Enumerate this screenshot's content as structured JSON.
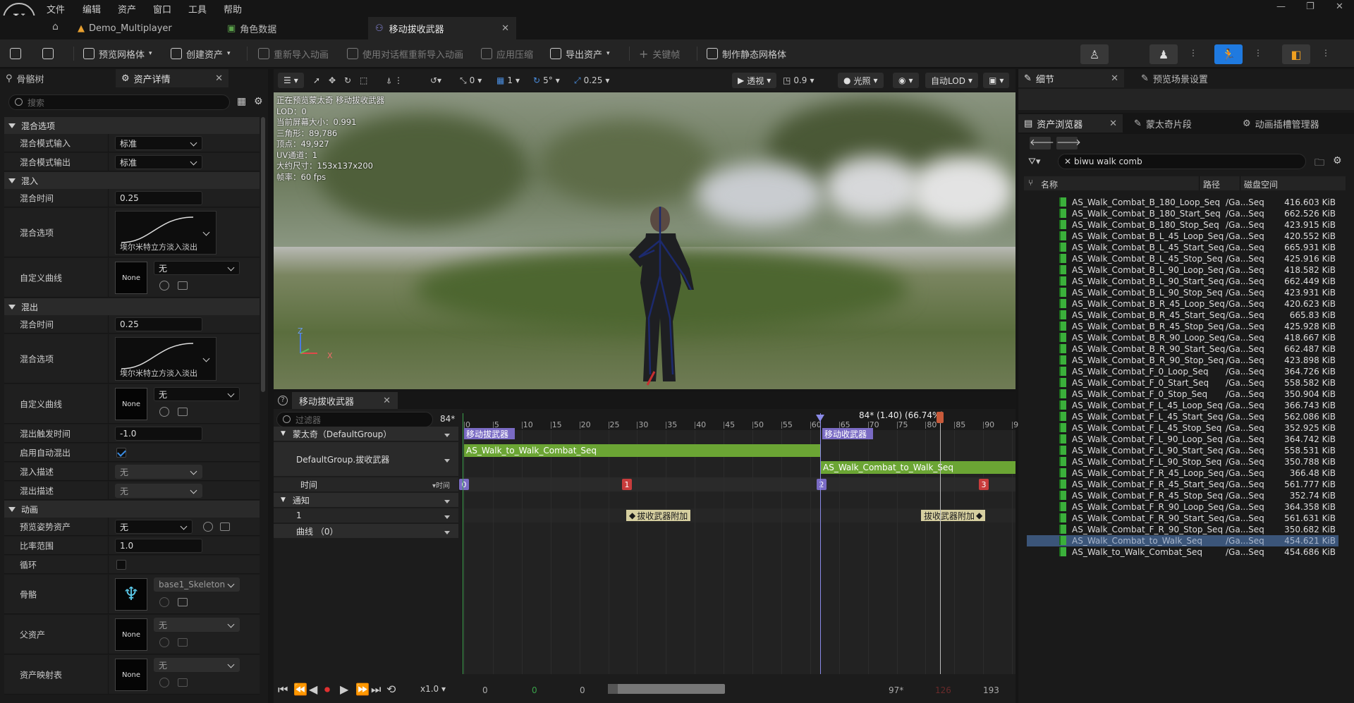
{
  "menu": {
    "items": [
      "文件",
      "编辑",
      "资产",
      "窗口",
      "工具",
      "帮助"
    ]
  },
  "tabs": [
    {
      "label": "Demo_Multiplayer"
    },
    {
      "label": "角色数据"
    },
    {
      "label": "移动拔收武器"
    }
  ],
  "toolbar": {
    "preview_mesh": "预览网格体",
    "create_asset": "创建资产",
    "reimport": "重新导入动画",
    "reimport_dialog": "使用对话框重新导入动画",
    "apply_compression": "应用压缩",
    "export_asset": "导出资产",
    "keyframe": "关键帧",
    "make_static_mesh": "制作静态网格体"
  },
  "left_panel": {
    "tabs": [
      "骨骼树",
      "资产详情"
    ],
    "search_placeholder": "搜索",
    "cat_blend": "混合选项",
    "blend_in_mode_label": "混合模式输入",
    "blend_in_mode": "标准",
    "blend_out_mode_label": "混合模式输出",
    "blend_out_mode": "标准",
    "cat_blendin": "混入",
    "blend_time_label": "混合时间",
    "blend_in_time": "0.25",
    "blend_option_label": "混合选项",
    "curve_caption": "埃尔米特立方淡入淡出",
    "custom_curve_label": "自定义曲线",
    "none_thumb": "None",
    "none_value": "无",
    "cat_blendout": "混出",
    "blend_out_time": "0.25",
    "blend_out_trigger_label": "混出触发时间",
    "blend_out_trigger": "-1.0",
    "auto_blend_out_label": "启用自动混出",
    "blend_in_profile_label": "混入描述",
    "blend_in_profile": "无",
    "blend_out_profile_label": "混出描述",
    "blend_out_profile": "无",
    "cat_anim": "动画",
    "preview_pose_label": "预览姿势资产",
    "preview_pose": "无",
    "rate_scale_label": "比率范围",
    "rate_scale": "1.0",
    "loop_label": "循环",
    "skeleton_label": "骨骼",
    "skeleton": "base1_Skeleton",
    "parent_asset_label": "父资产",
    "parent_asset": "无",
    "asset_mapping_label": "资产映射表",
    "asset_mapping": "无"
  },
  "viewport": {
    "toolbar": {
      "rot": "0",
      "grid": "1",
      "angle": "5°",
      "scale": "0.25",
      "perspective": "透视",
      "fov": "0.9",
      "lit": "光照",
      "lod": "自动LOD"
    },
    "stats": [
      "正在预览蒙太奇 移动拔收武器",
      "LOD：0",
      "当前屏幕大小：0.991",
      "三角形：89,786",
      "顶点：49,927",
      "UV通道：1",
      "大约尺寸：153x137x200",
      "帧率：60 fps"
    ],
    "axis_z": "Z",
    "axis_x": "X"
  },
  "right_panel": {
    "tabs": [
      "细节",
      "预览场景设置"
    ],
    "subtabs": [
      "资产浏览器",
      "蒙太奇片段",
      "动画插槽管理器"
    ],
    "search_value": "biwu walk comb",
    "columns": [
      "名称",
      "路径",
      "磁盘空间"
    ],
    "assets": [
      {
        "name": "AS_Walk_Combat_B_180_Loop_Seq",
        "path": "/Ga...Seq",
        "size": "416.603 KiB"
      },
      {
        "name": "AS_Walk_Combat_B_180_Start_Seq",
        "path": "/Ga...Seq",
        "size": "662.526 KiB"
      },
      {
        "name": "AS_Walk_Combat_B_180_Stop_Seq",
        "path": "/Ga...Seq",
        "size": "423.915 KiB"
      },
      {
        "name": "AS_Walk_Combat_B_L_45_Loop_Seq",
        "path": "/Ga...Seq",
        "size": "420.552 KiB"
      },
      {
        "name": "AS_Walk_Combat_B_L_45_Start_Seq",
        "path": "/Ga...Seq",
        "size": "665.931 KiB"
      },
      {
        "name": "AS_Walk_Combat_B_L_45_Stop_Seq",
        "path": "/Ga...Seq",
        "size": "425.916 KiB"
      },
      {
        "name": "AS_Walk_Combat_B_L_90_Loop_Seq",
        "path": "/Ga...Seq",
        "size": "418.582 KiB"
      },
      {
        "name": "AS_Walk_Combat_B_L_90_Start_Seq",
        "path": "/Ga...Seq",
        "size": "662.449 KiB"
      },
      {
        "name": "AS_Walk_Combat_B_L_90_Stop_Seq",
        "path": "/Ga...Seq",
        "size": "423.931 KiB"
      },
      {
        "name": "AS_Walk_Combat_B_R_45_Loop_Seq",
        "path": "/Ga...Seq",
        "size": "420.623 KiB"
      },
      {
        "name": "AS_Walk_Combat_B_R_45_Start_Seq",
        "path": "/Ga...Seq",
        "size": "665.83 KiB"
      },
      {
        "name": "AS_Walk_Combat_B_R_45_Stop_Seq",
        "path": "/Ga...Seq",
        "size": "425.928 KiB"
      },
      {
        "name": "AS_Walk_Combat_B_R_90_Loop_Seq",
        "path": "/Ga...Seq",
        "size": "418.667 KiB"
      },
      {
        "name": "AS_Walk_Combat_B_R_90_Start_Seq",
        "path": "/Ga...Seq",
        "size": "662.487 KiB"
      },
      {
        "name": "AS_Walk_Combat_B_R_90_Stop_Seq",
        "path": "/Ga...Seq",
        "size": "423.898 KiB"
      },
      {
        "name": "AS_Walk_Combat_F_0_Loop_Seq",
        "path": "/Ga...Seq",
        "size": "364.726 KiB"
      },
      {
        "name": "AS_Walk_Combat_F_0_Start_Seq",
        "path": "/Ga...Seq",
        "size": "558.582 KiB"
      },
      {
        "name": "AS_Walk_Combat_F_0_Stop_Seq",
        "path": "/Ga...Seq",
        "size": "350.904 KiB"
      },
      {
        "name": "AS_Walk_Combat_F_L_45_Loop_Seq",
        "path": "/Ga...Seq",
        "size": "366.743 KiB"
      },
      {
        "name": "AS_Walk_Combat_F_L_45_Start_Seq",
        "path": "/Ga...Seq",
        "size": "562.086 KiB"
      },
      {
        "name": "AS_Walk_Combat_F_L_45_Stop_Seq",
        "path": "/Ga...Seq",
        "size": "352.925 KiB"
      },
      {
        "name": "AS_Walk_Combat_F_L_90_Loop_Seq",
        "path": "/Ga...Seq",
        "size": "364.742 KiB"
      },
      {
        "name": "AS_Walk_Combat_F_L_90_Start_Seq",
        "path": "/Ga...Seq",
        "size": "558.531 KiB"
      },
      {
        "name": "AS_Walk_Combat_F_L_90_Stop_Seq",
        "path": "/Ga...Seq",
        "size": "350.788 KiB"
      },
      {
        "name": "AS_Walk_Combat_F_R_45_Loop_Seq",
        "path": "/Ga...Seq",
        "size": "366.48 KiB"
      },
      {
        "name": "AS_Walk_Combat_F_R_45_Start_Seq",
        "path": "/Ga...Seq",
        "size": "561.777 KiB"
      },
      {
        "name": "AS_Walk_Combat_F_R_45_Stop_Seq",
        "path": "/Ga...Seq",
        "size": "352.74 KiB"
      },
      {
        "name": "AS_Walk_Combat_F_R_90_Loop_Seq",
        "path": "/Ga...Seq",
        "size": "364.358 KiB"
      },
      {
        "name": "AS_Walk_Combat_F_R_90_Start_Seq",
        "path": "/Ga...Seq",
        "size": "561.631 KiB"
      },
      {
        "name": "AS_Walk_Combat_F_R_90_Stop_Seq",
        "path": "/Ga...Seq",
        "size": "350.682 KiB"
      },
      {
        "name": "AS_Walk_Combat_to_Walk_Seq",
        "path": "/Ga...Seq",
        "size": "454.621 KiB",
        "selected": true
      },
      {
        "name": "AS_Walk_to_Walk_Combat_Seq",
        "path": "/Ga...Seq",
        "size": "454.686 KiB"
      }
    ]
  },
  "timeline": {
    "tab": "移动拔收武器",
    "filter_placeholder": "过滤器",
    "frame_indicator": "84*",
    "playhead_label": "84* (1.40) (66.74%)",
    "tracks": {
      "montage": "蒙太奇（DefaultGroup）",
      "slot": "DefaultGroup.拔收武器",
      "time": "时间",
      "time_right": "时间",
      "notify": "通知",
      "notify_track": "1",
      "curves": "曲线 （0）"
    },
    "ticks": [
      "0",
      "5",
      "10",
      "15",
      "20",
      "25",
      "30",
      "35",
      "40",
      "45",
      "50",
      "55",
      "60",
      "65",
      "70",
      "75",
      "80",
      "85",
      "90",
      "95"
    ],
    "sections": [
      "移动拔武器",
      "移动收武器"
    ],
    "segments": [
      "AS_Walk_to_Walk_Combat_Seq",
      "AS_Walk_Combat_to_Walk_Seq"
    ],
    "keys": [
      "0",
      "1",
      "2",
      "3"
    ],
    "notifies": [
      "拔收武器附加",
      "拔收武器附加"
    ],
    "transport": {
      "speed": "x1.0",
      "start": "0",
      "green": "0",
      "cur": "0",
      "end_frame": "97*",
      "red": "126",
      "total": "193"
    }
  },
  "colors": {
    "accent": "#1f7ae0",
    "segment": "#6ba534",
    "section": "#7a6bc4",
    "key_red": "#c83c3c",
    "notify": "#d6cfa0"
  }
}
